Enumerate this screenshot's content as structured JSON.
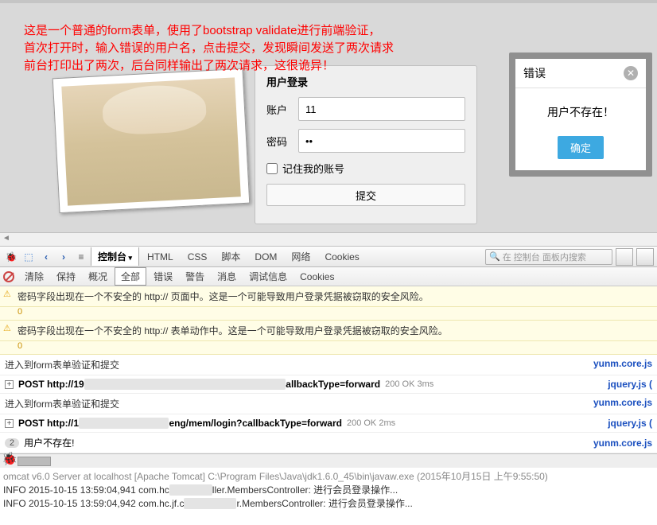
{
  "overlay": {
    "line1": "这是一个普通的form表单，使用了bootstrap validate进行前端验证，",
    "line2": "首次打开时，输入错误的用户名，点击提交，发现瞬间发送了两次请求",
    "line3": "前台打印出了两次，后台同样输出了两次请求，这很诡异！"
  },
  "form": {
    "title": "用户登录",
    "account_label": "账户",
    "account_value": "11",
    "password_label": "密码",
    "password_value": "••",
    "remember_label": "记住我的账号",
    "submit_label": "提交"
  },
  "dialog": {
    "title": "错误",
    "message": "用户不存在！",
    "ok_label": "确定"
  },
  "devtools": {
    "tabs": {
      "console": "控制台",
      "html": "HTML",
      "css": "CSS",
      "script": "脚本",
      "dom": "DOM",
      "net": "网络",
      "cookies": "Cookies"
    },
    "search_placeholder": "在 控制台 面板内搜索",
    "sub": {
      "clear": "清除",
      "keep": "保持",
      "overview": "概况",
      "all": "全部",
      "error": "错误",
      "warn": "警告",
      "msg": "消息",
      "debug": "调试信息",
      "cookies": "Cookies"
    },
    "warn1": "密码字段出现在一个不安全的 http:// 页面中。这是一个可能导致用户登录凭据被窃取的安全风险。",
    "warn1_count": "0",
    "warn2": "密码字段出现在一个不安全的 http:// 表单动作中。这是一个可能导致用户登录凭据被窃取的安全风险。",
    "warn2_count": "0",
    "log1": "进入到form表单验证和提交",
    "log1_src": "yunm.core.js",
    "post1_pre": "POST http://19",
    "post1_suf": "allbackType=forward",
    "post1_status": "200 OK 3ms",
    "post1_src": "jquery.js (",
    "log2": "进入到form表单验证和提交",
    "log2_src": "yunm.core.js",
    "post2_pre": "POST http://1",
    "post2_suf": "eng/mem/login?callbackType=forward",
    "post2_status": "200 OK 2ms",
    "post2_src": "jquery.js (",
    "count": "2",
    "count_msg": "用户不存在!",
    "count_src": "yunm.core.js"
  },
  "server": {
    "line1": "omcat v6.0 Server at localhost [Apache Tomcat] C:\\Program Files\\Java\\jdk1.6.0_45\\bin\\javaw.exe (2015年10月15日 上午9:55:50)",
    "line2a": "INFO 2015-10-15 13:59:04,941 com.hc",
    "line2b": "ller.MembersController: 进行会员登录操作...",
    "line3a": "INFO 2015-10-15 13:59:04,942 com.hc.jf.c",
    "line3b": "r.MembersController: 进行会员登录操作..."
  }
}
